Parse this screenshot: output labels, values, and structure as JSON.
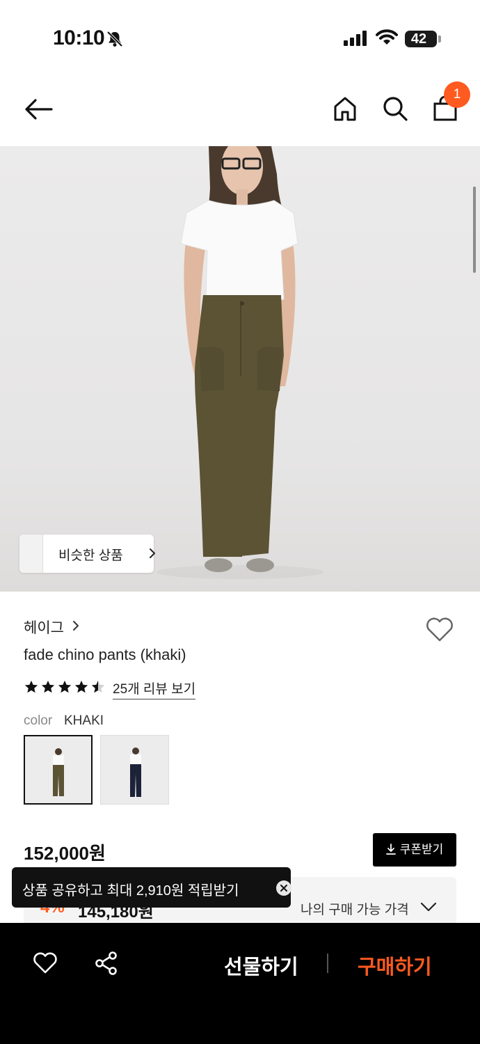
{
  "status_bar": {
    "time": "10:10",
    "battery": "42"
  },
  "nav": {
    "cart_count": "1"
  },
  "hero": {
    "similar_label": "비슷한 상품"
  },
  "product": {
    "brand": "헤이그",
    "name": "fade chino pants (khaki)",
    "rating_stars": 4.5,
    "review_link": "25개 리뷰 보기",
    "color_label": "color",
    "color_value": "KHAKI",
    "color_options": [
      "khaki",
      "navy"
    ]
  },
  "pricing": {
    "price": "152,000원",
    "coupon_button": "쿠폰받기",
    "discount_rate": "4%",
    "discount_price": "145,180원",
    "my_price_label": "나의 구매 가능 가격"
  },
  "toast": {
    "message": "상품 공유하고 최대 2,910원 적립받기"
  },
  "bottom_bar": {
    "gift_label": "선물하기",
    "buy_label": "구매하기"
  },
  "colors": {
    "accent": "#ff5a1f",
    "black": "#000000",
    "text": "#111111"
  }
}
